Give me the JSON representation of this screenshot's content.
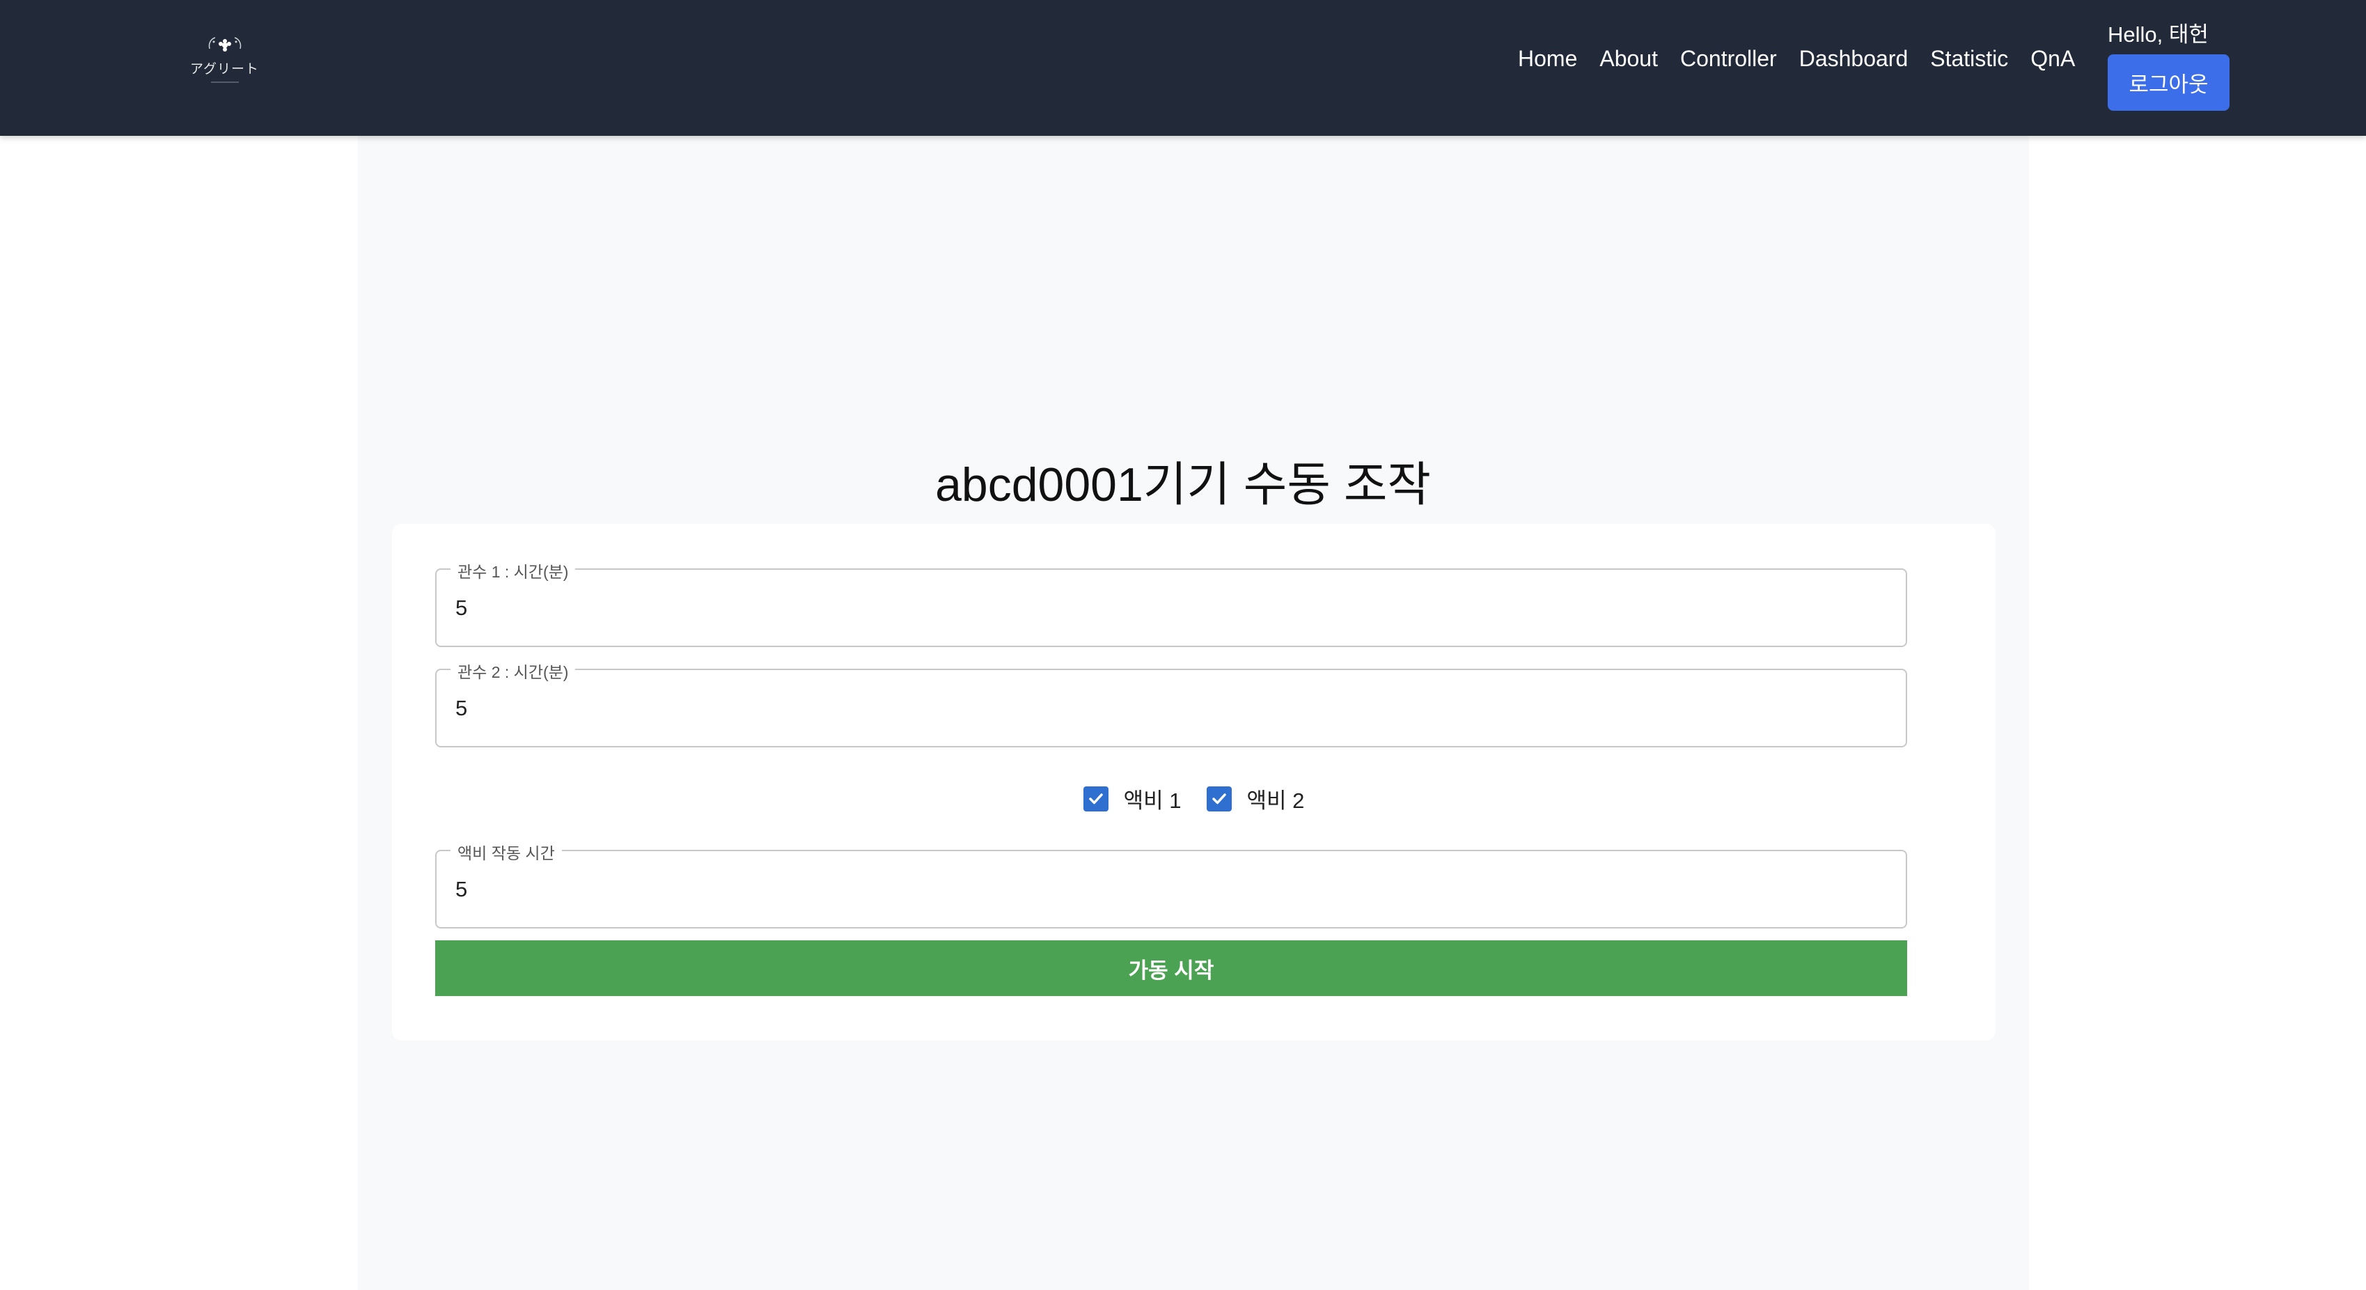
{
  "header": {
    "logo_text": "アグリート",
    "nav": [
      "Home",
      "About",
      "Controller",
      "Dashboard",
      "Statistic",
      "QnA"
    ],
    "greeting": "Hello, 태헌",
    "logout_label": "로그아웃"
  },
  "main": {
    "title": "abcd0001기기 수동 조작",
    "irrigation1": {
      "label": "관수 1 : 시간(분)",
      "value": "5"
    },
    "irrigation2": {
      "label": "관수 2 : 시간(분)",
      "value": "5"
    },
    "checkboxes": [
      {
        "label": "액비 1",
        "checked": true
      },
      {
        "label": "액비 2",
        "checked": true
      }
    ],
    "fertilizer_time": {
      "label": "액비 작동 시간",
      "value": "5"
    },
    "start_label": "가동 시작"
  },
  "colors": {
    "navbar": "#222938",
    "logout_button": "#3b6ee8",
    "checkbox": "#2f6fd0",
    "start_button": "#4ca253",
    "content_bg": "#f8f9fa"
  }
}
